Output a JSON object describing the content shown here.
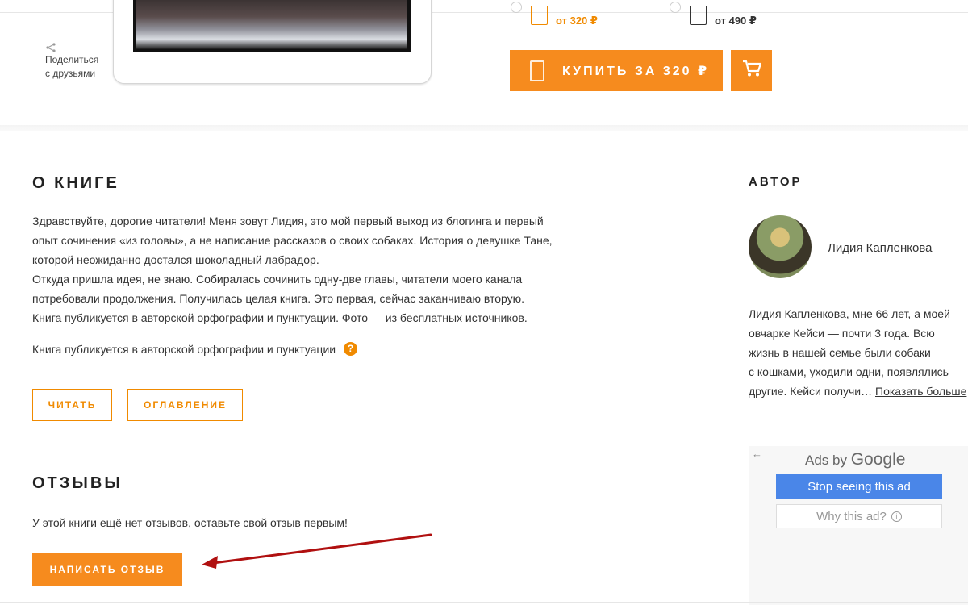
{
  "share": {
    "label_line1": "Поделиться",
    "label_line2": "с друзьями"
  },
  "formats": [
    {
      "price": "от 320 ₽",
      "selected": true
    },
    {
      "price": "от 490 ₽",
      "selected": false
    }
  ],
  "buy": {
    "label": "КУПИТЬ ЗА 320 ₽"
  },
  "colors": {
    "accent": "#f68b1e",
    "ad_button": "#4a86e8",
    "annotation_arrow": "#b01010"
  },
  "about": {
    "title": "О КНИГЕ",
    "paragraphs": [
      "Здравствуйте, дорогие читатели! Меня зовут Лидия, это мой первый выход из блогинга и первый",
      "опыт сочинения «из головы», а не написание рассказов о своих собаках. История о девушке Тане,",
      "которой неожиданно достался шоколадный лабрадор.",
      "Откуда пришла идея, не знаю. Собиралась сочинить одну-две главы, читатели моего канала",
      "потребовали продолжения. Получилась целая книга. Это первая, сейчас заканчиваю вторую.",
      "Книга публикуется в авторской орфографии и пунктуации. Фото — из бесплатных источников."
    ],
    "note": "Книга публикуется в авторской орфографии и пунктуации",
    "help_label": "?",
    "read_button": "ЧИТАТЬ",
    "toc_button": "ОГЛАВЛЕНИЕ"
  },
  "reviews": {
    "title": "ОТЗЫВЫ",
    "empty_text": "У этой книги ещё нет отзывов, оставьте свой отзыв первым!",
    "write_button": "НАПИСАТЬ ОТЗЫВ"
  },
  "author": {
    "title": "АВТОР",
    "name": "Лидия Капленкова",
    "bio_lines": [
      "Лидия Капленкова, мне 66 лет, а моей",
      "овчарке Кейси — почти 3 года. Всю",
      "жизнь в нашей семье были собаки",
      "с кошками, уходили одни, появлялись",
      "другие. Кейси получи…"
    ],
    "show_more": "Показать больше"
  },
  "ad": {
    "ads_by": "Ads by",
    "google": "Google",
    "stop_label": "Stop seeing this ad",
    "why_label": "Why this ad?",
    "info_glyph": "i"
  }
}
